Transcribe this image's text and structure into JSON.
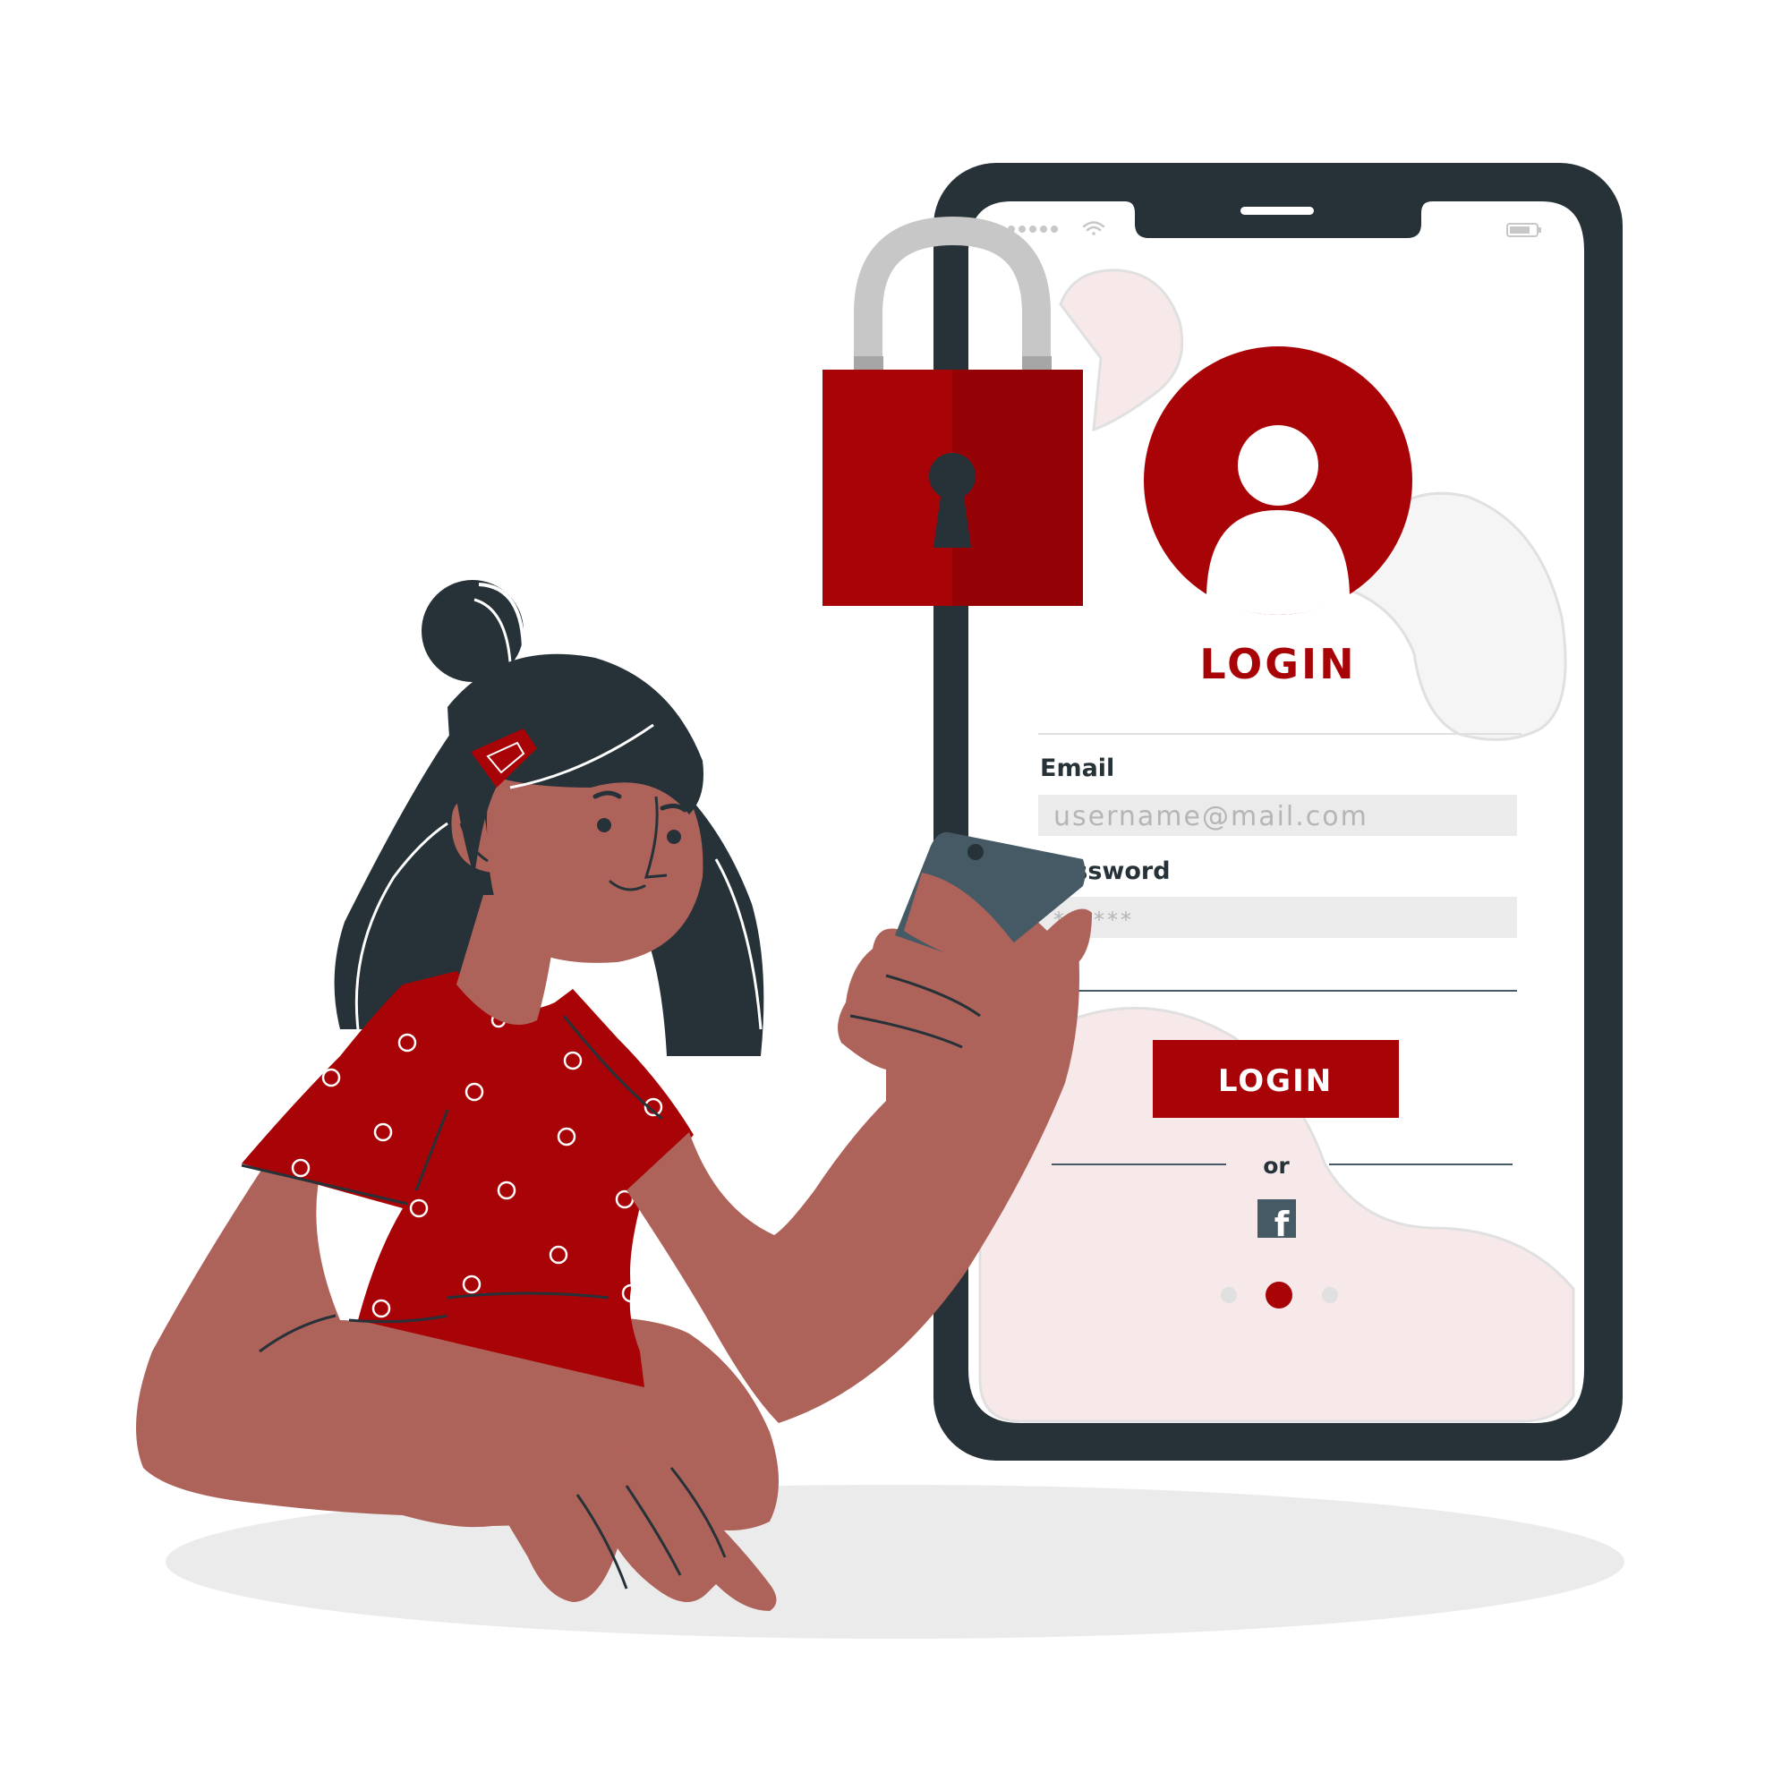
{
  "login_screen": {
    "heading": "LOGIN",
    "email_label": "Email",
    "email_placeholder": "username@mail.com",
    "password_label": "Password",
    "password_placeholder": "******",
    "login_button_label": "LOGIN",
    "divider_text": "or",
    "facebook_glyph": "f",
    "page_dots": {
      "count": 3,
      "active_index": 1
    }
  },
  "icons": {
    "padlock": "padlock-icon",
    "user": "user-avatar-icon",
    "facebook": "facebook-icon",
    "wifi": "wifi-icon",
    "battery": "battery-icon",
    "signal": "signal-dots-icon"
  },
  "colors": {
    "accent": "#a80306",
    "accent_dark": "#940205",
    "phone_frame": "#263238",
    "skin": "#ae635a",
    "field_bg": "#ebebeb",
    "blob_pink": "#f7e9ea",
    "shadow": "#ebebeb"
  }
}
